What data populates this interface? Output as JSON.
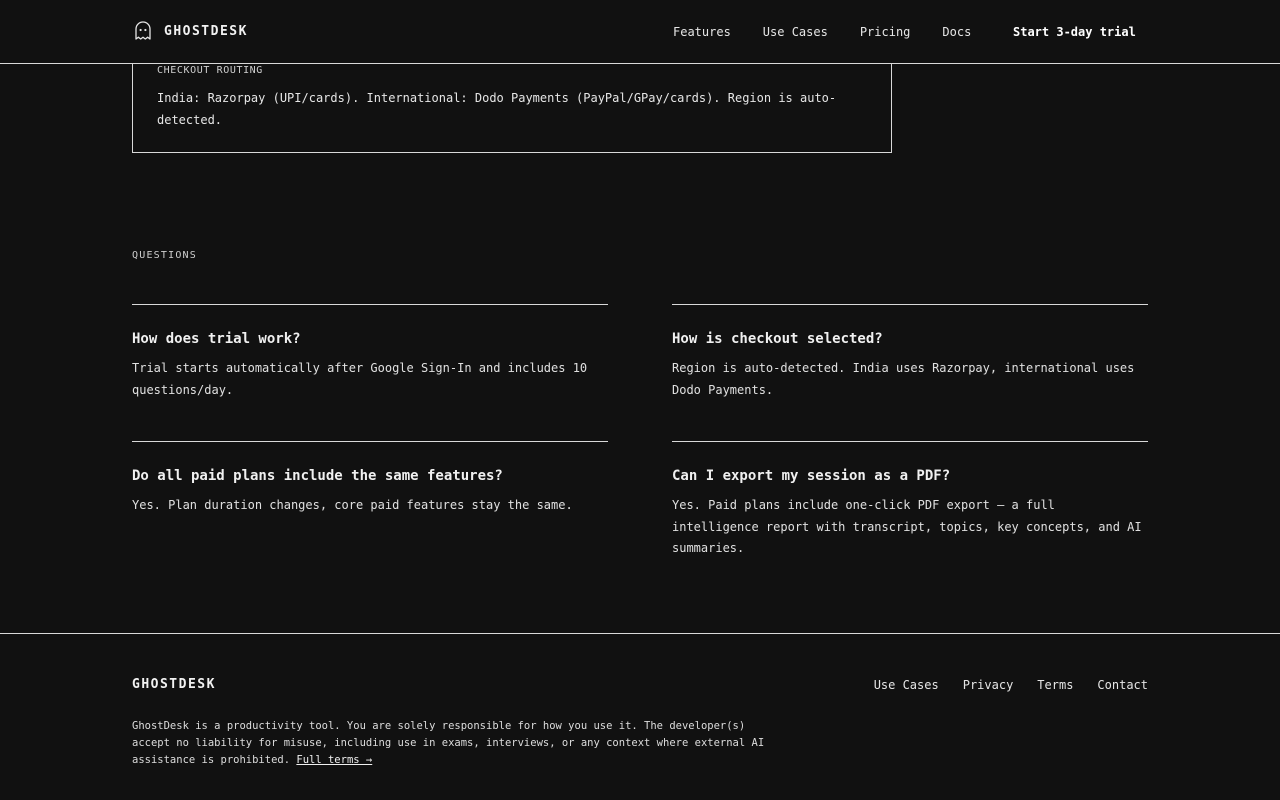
{
  "header": {
    "brand": "GHOSTDESK",
    "logo_icon": "ghost-icon",
    "nav": [
      "Features",
      "Use Cases",
      "Pricing",
      "Docs"
    ],
    "cta": "Start 3-day trial"
  },
  "routing": {
    "label": "CHECKOUT ROUTING",
    "text": "India: Razorpay (UPI/cards). International: Dodo Payments (PayPal/GPay/cards). Region is auto-detected."
  },
  "questions": {
    "label": "QUESTIONS",
    "items": [
      {
        "q": "How does trial work?",
        "a": "Trial starts automatically after Google Sign-In and includes 10 questions/day."
      },
      {
        "q": "How is checkout selected?",
        "a": "Region is auto-detected. India uses Razorpay, international uses Dodo Payments."
      },
      {
        "q": "Do all paid plans include the same features?",
        "a": "Yes. Plan duration changes, core paid features stay the same."
      },
      {
        "q": "Can I export my session as a PDF?",
        "a": "Yes. Paid plans include one-click PDF export — a full intelligence report with transcript, topics, key concepts, and AI summaries."
      }
    ]
  },
  "footer": {
    "brand": "GHOSTDESK",
    "links": [
      "Use Cases",
      "Privacy",
      "Terms",
      "Contact"
    ],
    "disclaimer": "GhostDesk is a productivity tool. You are solely responsible for how you use it. The developer(s) accept no liability for misuse, including use in exams, interviews, or any context where external AI assistance is prohibited.",
    "terms_link": "Full terms →"
  },
  "colors": {
    "background": "#111111",
    "text": "#e6e6e6",
    "border": "#d9d9d9"
  }
}
